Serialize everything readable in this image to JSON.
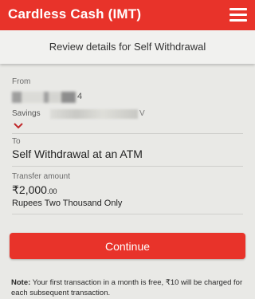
{
  "appbar": {
    "title": "Cardless Cash (IMT)",
    "menu_icon": "hamburger-menu-icon"
  },
  "subheader": {
    "title": "Review details for Self Withdrawal"
  },
  "from": {
    "label": "From",
    "account_suffix": "4",
    "account_type": "Savings",
    "account_trail": "V"
  },
  "to": {
    "label": "To",
    "value": "Self Withdrawal at an ATM"
  },
  "amount": {
    "label": "Transfer amount",
    "major": "₹2,000",
    "minor": ".00",
    "words": "Rupees Two Thousand Only"
  },
  "actions": {
    "continue_label": "Continue"
  },
  "note": {
    "prefix": "Note:",
    "text": "Your first transaction in a month is free, ₹10 will be charged for each subsequent transaction."
  },
  "colors": {
    "brand": "#e8332a",
    "background": "#e9e9e6",
    "chevron": "#c0282a"
  }
}
